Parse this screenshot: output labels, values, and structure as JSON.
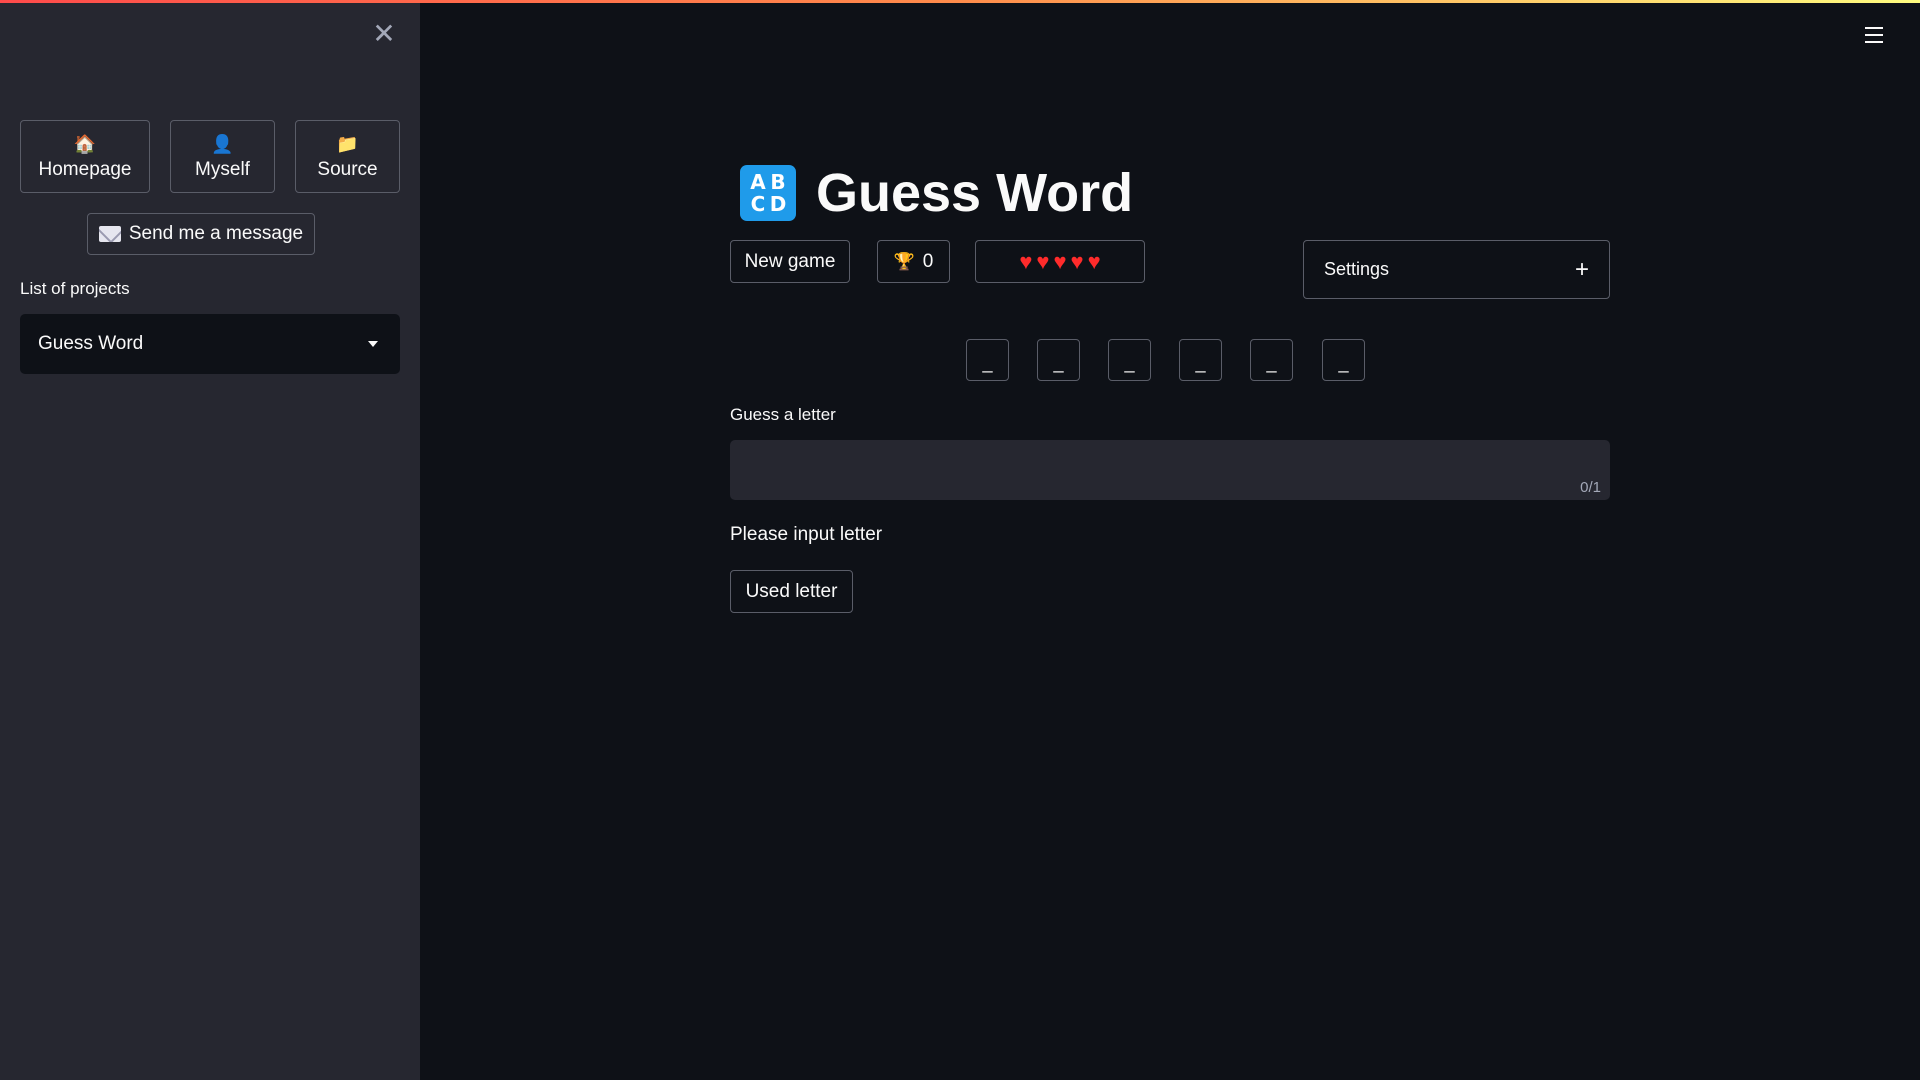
{
  "sidebar": {
    "close_icon": "close-icon",
    "nav_buttons": [
      {
        "label": "Homepage",
        "icon": "house-icon",
        "glyph": "🏠"
      },
      {
        "label": "Myself",
        "icon": "person-icon",
        "glyph": "👤"
      },
      {
        "label": "Source",
        "icon": "folder-icon",
        "glyph": "📁"
      }
    ],
    "message_button": {
      "label": "Send me a message",
      "icon": "envelope-icon"
    },
    "projects_label": "List of projects",
    "projects_select": {
      "value": "Guess Word"
    }
  },
  "main": {
    "app_icon": {
      "name": "abcd-icon",
      "letters": [
        "A",
        "B",
        "C",
        "D"
      ]
    },
    "title": "Guess Word",
    "new_game_label": "New game",
    "score": {
      "icon": "trophy-icon",
      "glyph": "🏆",
      "value": "0"
    },
    "lives": {
      "icon": "heart-icon",
      "count": 5,
      "glyph": "♥"
    },
    "settings": {
      "label": "Settings",
      "icon": "plus-icon",
      "glyph": "+"
    },
    "word_slots": [
      "_",
      "_",
      "_",
      "_",
      "_",
      "_"
    ],
    "guess": {
      "label": "Guess a letter",
      "value": "",
      "counter": "0/1"
    },
    "hint": "Please input letter",
    "used_letter_label": "Used letter"
  },
  "colors": {
    "background": "#0e1117",
    "sidebar": "#262730",
    "heart": "#ff2b2b",
    "app_icon": "#1f9bea"
  }
}
